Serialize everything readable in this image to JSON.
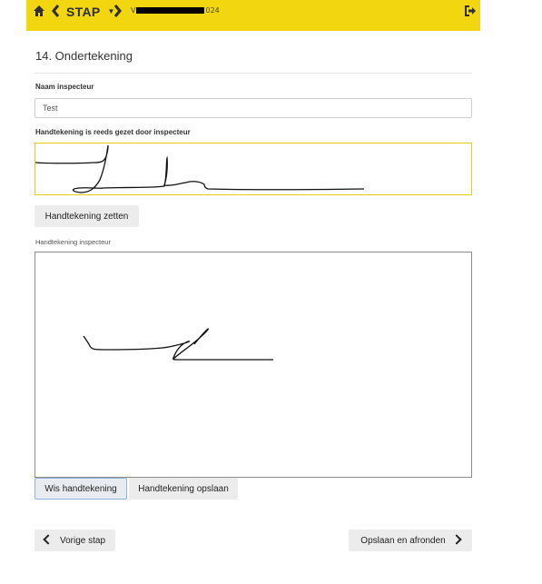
{
  "header": {
    "step_label": "STAP",
    "project_id_prefix": "V",
    "project_id_suffix": "024",
    "icons": [
      "home-icon",
      "chevron-left-icon",
      "caret-down-icon",
      "chevron-right-icon",
      "sign-out-icon"
    ],
    "accent_color": "#f2d60f"
  },
  "section": {
    "title": "14. Ondertekening"
  },
  "form": {
    "inspector_name_label": "Naam inspecteur",
    "inspector_name_value": "Test",
    "saved_signature_label": "Handtekening is reeds gezet door inspecteur",
    "set_signature_button": "Handtekening zetten",
    "signature_pad_label": "Handtekening inspecteur",
    "clear_signature_button": "Wis handtekening",
    "save_signature_button": "Handtekening opslaan"
  },
  "footer": {
    "prev_button": "Vorige stap",
    "next_button": "Opslaan en afronden"
  }
}
